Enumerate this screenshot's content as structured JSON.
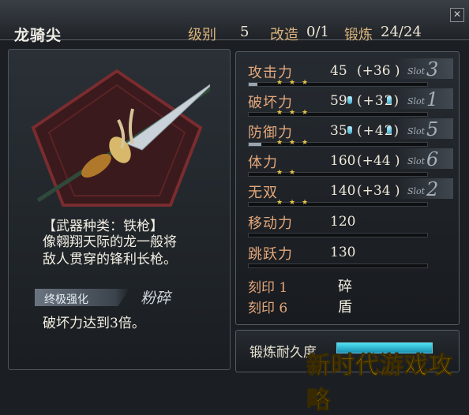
{
  "header": {
    "weapon_name": "龙骑尖",
    "level_label": "级别",
    "level_value": "5",
    "modify_label": "改造",
    "modify_value": "0/1",
    "forge_label": "锻炼",
    "forge_value": "24/24"
  },
  "weapon": {
    "type_label": "【武器种类：铁枪】",
    "description_line1": "像翱翔天际的龙一般将",
    "description_line2": "敌人贯穿的锋利长枪。",
    "ultimate_label": "终极强化",
    "ultimate_name": "粉碎",
    "ultimate_effect": "破坏力达到3倍。"
  },
  "stats": [
    {
      "name": "攻击力",
      "value": "45",
      "bonus": "(+36 )",
      "slot": "3",
      "stars": 3,
      "gems": 0,
      "bar": 0.05
    },
    {
      "name": "破坏力",
      "value": "59",
      "bonus": "(+32)",
      "slot": "1",
      "stars": 3,
      "gems": 2,
      "bar": 0.0
    },
    {
      "name": "防御力",
      "value": "35",
      "bonus": "(+42)",
      "slot": "5",
      "stars": 3,
      "gems": 2,
      "bar": 0.07
    },
    {
      "name": "体力",
      "value": "160",
      "bonus": "(+44 )",
      "slot": "6",
      "stars": 2,
      "gems": 0,
      "bar": 0.0
    },
    {
      "name": "无双",
      "value": "140",
      "bonus": "(+34 )",
      "slot": "2",
      "stars": 3,
      "gems": 0,
      "bar": 0.0
    },
    {
      "name": "移动力",
      "value": "120"
    },
    {
      "name": "跳跃力",
      "value": "130"
    }
  ],
  "slot_label": "Slot",
  "seals": [
    {
      "name": "刻印 1",
      "value": "碎"
    },
    {
      "name": "刻印 6",
      "value": "盾"
    }
  ],
  "forge_durability_label": "锻炼耐久度",
  "forge_durability": 1.0,
  "watermark": "新时代游戏攻略",
  "colors": {
    "stat_label": "#e4a77a",
    "header_label": "#d9b27a",
    "gem": "#5cc8e4",
    "star": "#e8c54a",
    "watermark": "#f2c400"
  }
}
